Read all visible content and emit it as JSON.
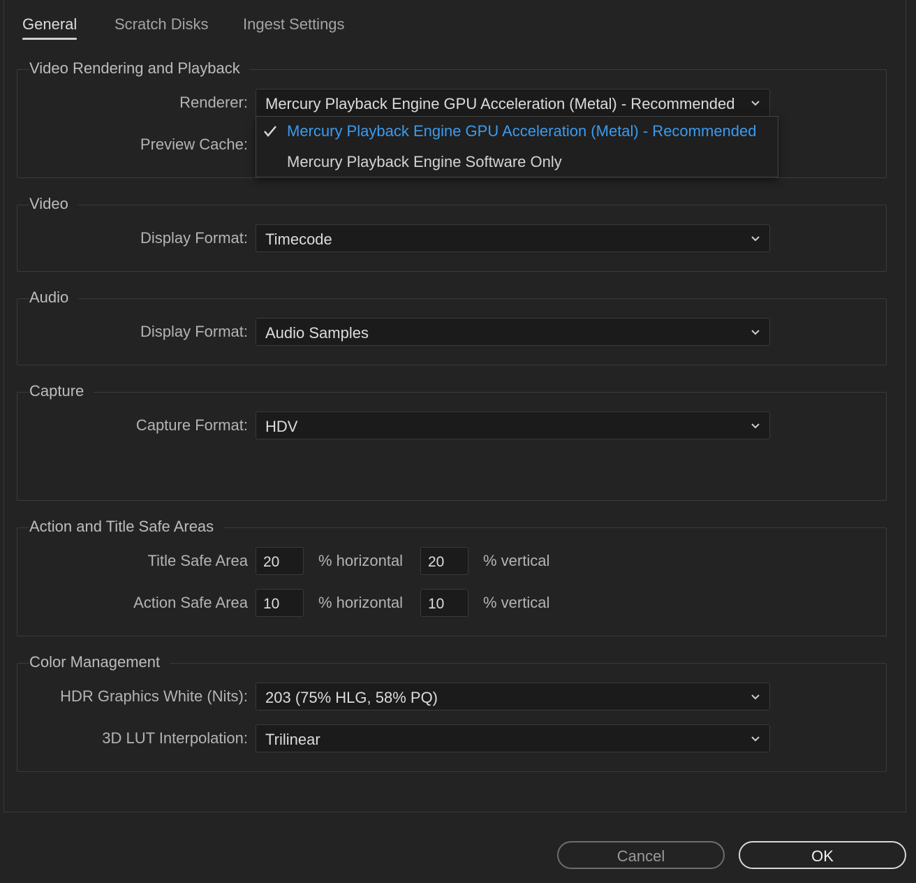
{
  "tabs": [
    {
      "label": "General",
      "active": true
    },
    {
      "label": "Scratch Disks",
      "active": false
    },
    {
      "label": "Ingest Settings",
      "active": false
    }
  ],
  "video_rendering": {
    "title": "Video Rendering and Playback",
    "renderer_label": "Renderer:",
    "renderer_value": "Mercury Playback Engine GPU Acceleration (Metal) - Recommended",
    "preview_cache_label": "Preview Cache:",
    "renderer_options": [
      {
        "label": "Mercury Playback Engine GPU Acceleration (Metal) - Recommended",
        "selected": true
      },
      {
        "label": "Mercury Playback Engine Software Only",
        "selected": false
      }
    ]
  },
  "video": {
    "title": "Video",
    "display_format_label": "Display Format:",
    "display_format_value": "Timecode"
  },
  "audio": {
    "title": "Audio",
    "display_format_label": "Display Format:",
    "display_format_value": "Audio Samples"
  },
  "capture": {
    "title": "Capture",
    "capture_format_label": "Capture Format:",
    "capture_format_value": "HDV"
  },
  "safe_areas": {
    "title": "Action and Title Safe Areas",
    "title_safe_label": "Title Safe Area",
    "title_safe_horizontal": "20",
    "title_safe_vertical": "20",
    "action_safe_label": "Action Safe Area",
    "action_safe_horizontal": "10",
    "action_safe_vertical": "10",
    "horizontal_unit": "% horizontal",
    "vertical_unit": "% vertical"
  },
  "color_management": {
    "title": "Color Management",
    "hdr_white_label": "HDR Graphics White (Nits):",
    "hdr_white_value": "203 (75% HLG, 58% PQ)",
    "lut_label": "3D LUT Interpolation:",
    "lut_value": "Trilinear"
  },
  "buttons": {
    "cancel": "Cancel",
    "ok": "OK"
  },
  "colors": {
    "background": "#232323",
    "selected_option": "#3b9bee",
    "field_background": "#1b1b1b"
  },
  "icons": {
    "dropdown": "chevron-down-icon",
    "selected": "checkmark-icon"
  }
}
